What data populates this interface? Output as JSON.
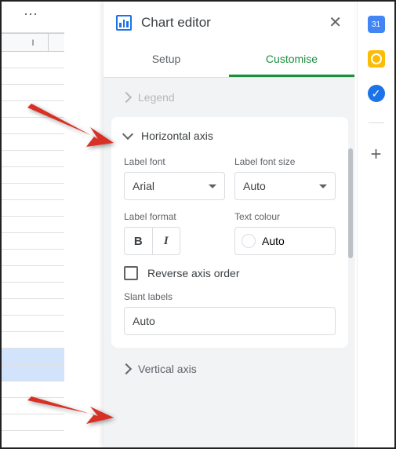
{
  "sheet": {
    "col_label": "I"
  },
  "panel": {
    "title": "Chart editor",
    "tabs": {
      "setup": "Setup",
      "customise": "Customise"
    },
    "legend_section": "Legend",
    "haxis": {
      "title": "Horizontal axis",
      "label_font": "Label font",
      "label_font_value": "Arial",
      "label_font_size": "Label font size",
      "label_font_size_value": "Auto",
      "label_format": "Label format",
      "text_colour": "Text colour",
      "text_colour_value": "Auto",
      "reverse": "Reverse axis order",
      "slant": "Slant labels",
      "slant_value": "Auto"
    },
    "vaxis": {
      "title": "Vertical axis"
    }
  }
}
